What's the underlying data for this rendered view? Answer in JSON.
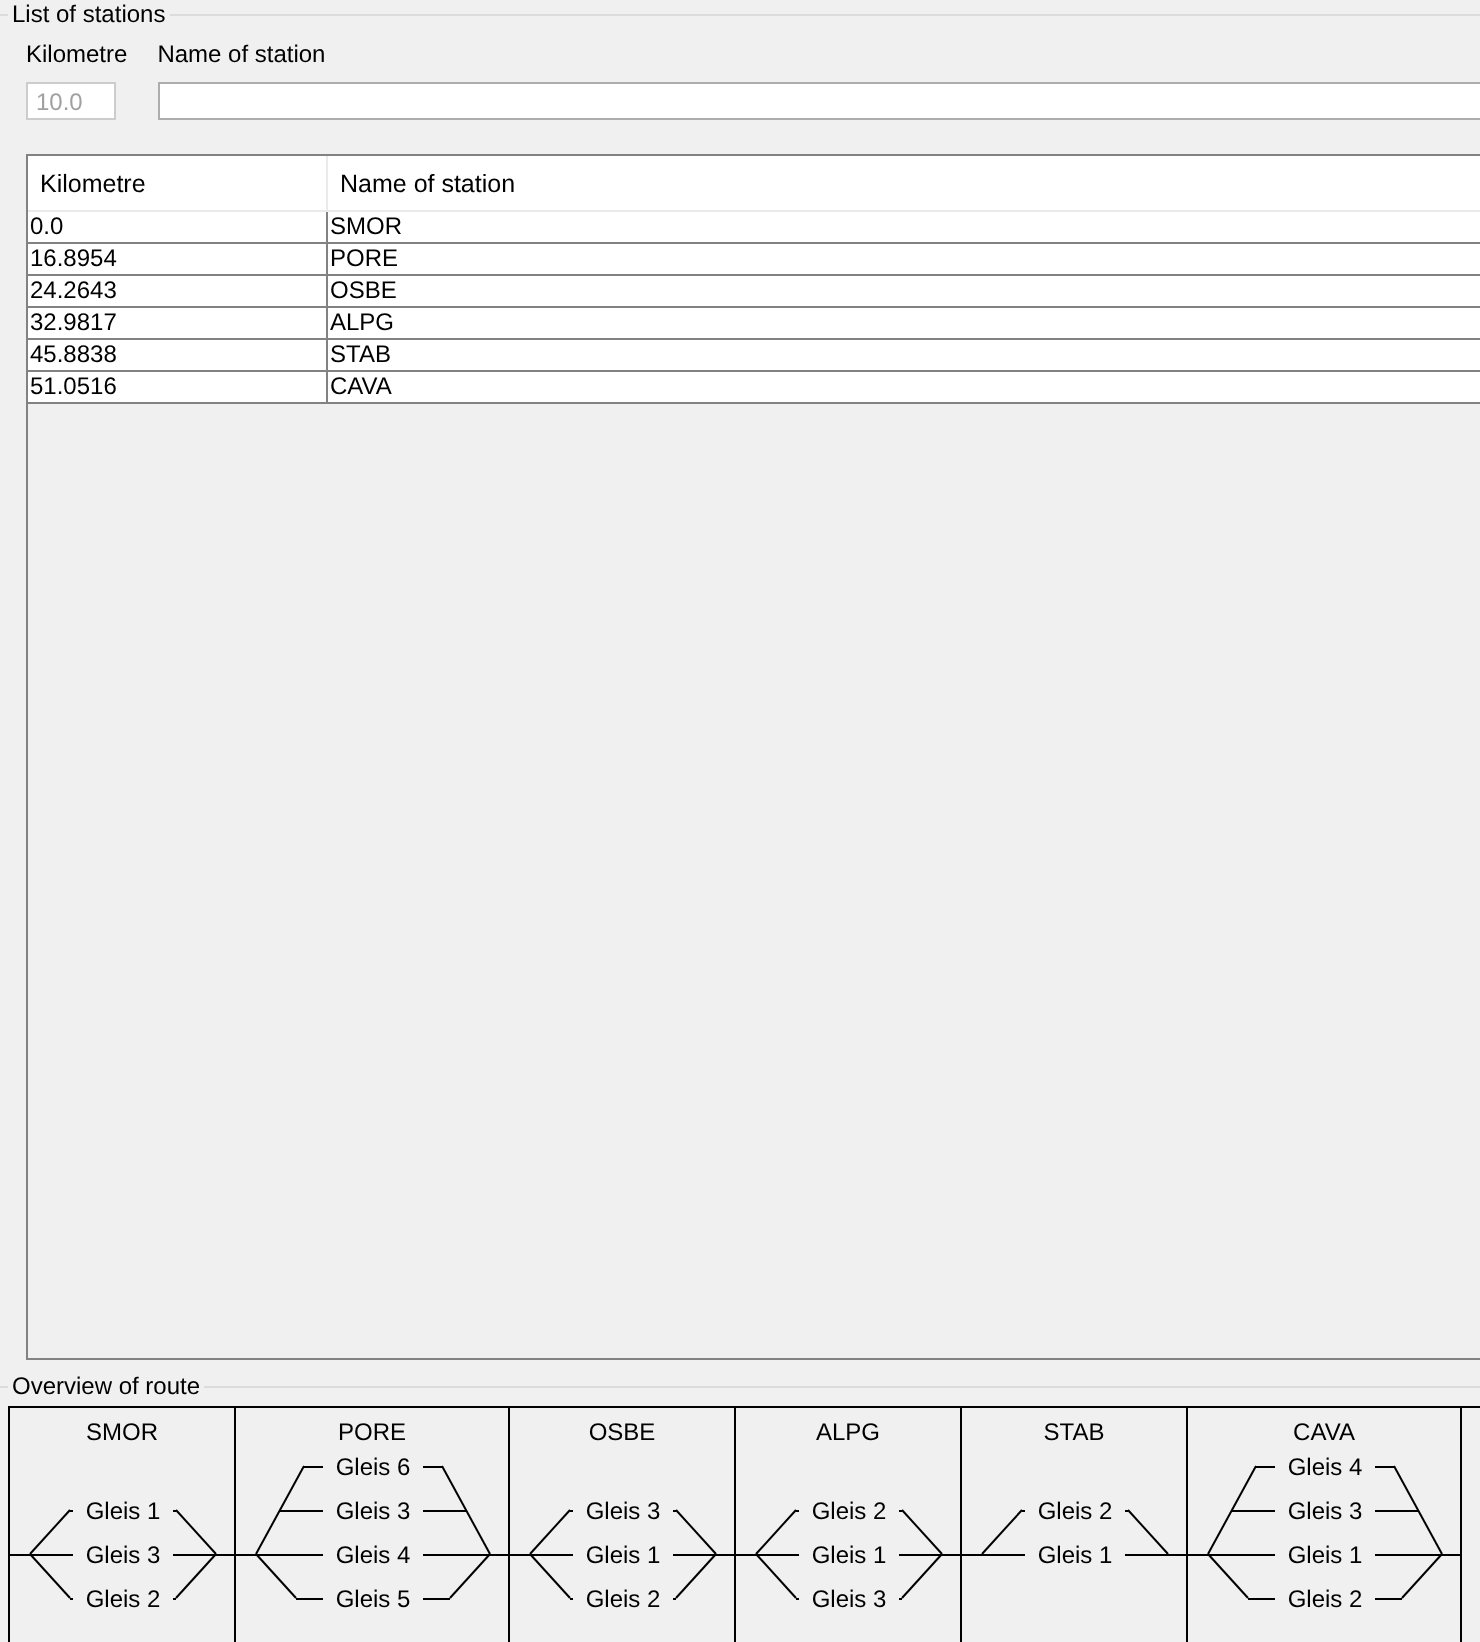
{
  "stations_panel": {
    "title": "List of stations",
    "form": {
      "kilometre_label": "Kilometre",
      "kilometre_value": "10.0",
      "kilometre_disabled": true,
      "name_label": "Name of station"
    },
    "table": {
      "columns": [
        "Kilometre",
        "Name of station"
      ],
      "rows": [
        [
          "0.0",
          "SMOR"
        ],
        [
          "16.8954",
          "PORE"
        ],
        [
          "24.2643",
          "OSBE"
        ],
        [
          "32.9817",
          "ALPG"
        ],
        [
          "45.8838",
          "STAB"
        ],
        [
          "51.0516",
          "CAVA"
        ]
      ]
    }
  },
  "route_panel": {
    "title": "Overview of route",
    "stations": [
      {
        "name": "SMOR",
        "tracks": [
          {
            "label": "Gleis 1",
            "main": false
          },
          {
            "label": "Gleis 3",
            "main": true
          },
          {
            "label": "Gleis 2",
            "main": false
          }
        ]
      },
      {
        "name": "PORE",
        "tracks": [
          {
            "label": "Gleis 6",
            "main": false
          },
          {
            "label": "Gleis 3",
            "main": false
          },
          {
            "label": "Gleis 4",
            "main": true
          },
          {
            "label": "Gleis 5",
            "main": false
          }
        ]
      },
      {
        "name": "OSBE",
        "tracks": [
          {
            "label": "Gleis 3",
            "main": false
          },
          {
            "label": "Gleis 1",
            "main": true
          },
          {
            "label": "Gleis 2",
            "main": false
          }
        ]
      },
      {
        "name": "ALPG",
        "tracks": [
          {
            "label": "Gleis 2",
            "main": false
          },
          {
            "label": "Gleis 1",
            "main": true
          },
          {
            "label": "Gleis 3",
            "main": false
          }
        ]
      },
      {
        "name": "STAB",
        "tracks": [
          {
            "label": "Gleis 2",
            "main": false
          },
          {
            "label": "Gleis 1",
            "main": true
          }
        ]
      },
      {
        "name": "CAVA",
        "tracks": [
          {
            "label": "Gleis 4",
            "main": false
          },
          {
            "label": "Gleis 3",
            "main": false
          },
          {
            "label": "Gleis 1",
            "main": true
          },
          {
            "label": "Gleis 2",
            "main": false
          }
        ]
      }
    ]
  }
}
